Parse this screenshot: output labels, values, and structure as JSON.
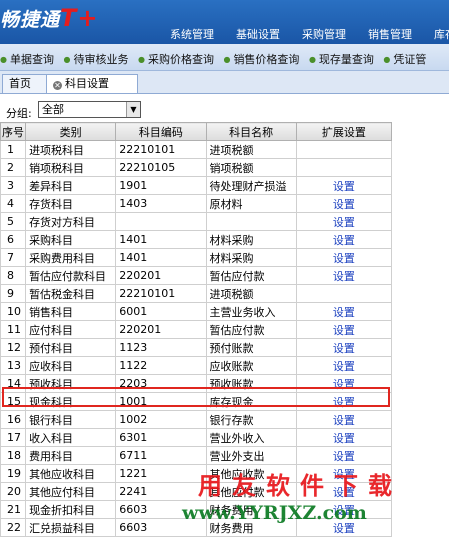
{
  "app": {
    "logo_text": "畅捷通",
    "logo_mark": "T+"
  },
  "main_nav": [
    "系统管理",
    "基础设置",
    "采购管理",
    "销售管理",
    "库存"
  ],
  "quick_links": [
    "单据查询",
    "待审核业务",
    "采购价格查询",
    "销售价格查询",
    "现存量查询",
    "凭证管"
  ],
  "tabs": {
    "home": "首页",
    "active": "科目设置"
  },
  "filter": {
    "label": "分组:",
    "value": "全部"
  },
  "table": {
    "headers": [
      "序号",
      "类别",
      "科目编码",
      "科目名称",
      "扩展设置"
    ],
    "rows": [
      {
        "no": "1",
        "type": "进项税科目",
        "code": "22210101",
        "name": "进项税额",
        "set": ""
      },
      {
        "no": "2",
        "type": "销项税科目",
        "code": "22210105",
        "name": "销项税额",
        "set": ""
      },
      {
        "no": "3",
        "type": "差异科目",
        "code": "1901",
        "name": "待处理财产损溢",
        "set": "设置"
      },
      {
        "no": "4",
        "type": "存货科目",
        "code": "1403",
        "name": "原材料",
        "set": "设置"
      },
      {
        "no": "5",
        "type": "存货对方科目",
        "code": "",
        "name": "",
        "set": "设置"
      },
      {
        "no": "6",
        "type": "采购科目",
        "code": "1401",
        "name": "材料采购",
        "set": "设置"
      },
      {
        "no": "7",
        "type": "采购费用科目",
        "code": "1401",
        "name": "材料采购",
        "set": "设置"
      },
      {
        "no": "8",
        "type": "暂估应付款科目",
        "code": "220201",
        "name": "暂估应付款",
        "set": "设置"
      },
      {
        "no": "9",
        "type": "暂估税金科目",
        "code": "22210101",
        "name": "进项税额",
        "set": ""
      },
      {
        "no": "10",
        "type": "销售科目",
        "code": "6001",
        "name": "主营业务收入",
        "set": "设置"
      },
      {
        "no": "11",
        "type": "应付科目",
        "code": "220201",
        "name": "暂估应付款",
        "set": "设置"
      },
      {
        "no": "12",
        "type": "预付科目",
        "code": "1123",
        "name": "预付账款",
        "set": "设置"
      },
      {
        "no": "13",
        "type": "应收科目",
        "code": "1122",
        "name": "应收账款",
        "set": "设置"
      },
      {
        "no": "14",
        "type": "预收科目",
        "code": "2203",
        "name": "预收账款",
        "set": "设置"
      },
      {
        "no": "15",
        "type": "现金科目",
        "code": "1001",
        "name": "库存现金",
        "set": "设置"
      },
      {
        "no": "16",
        "type": "银行科目",
        "code": "1002",
        "name": "银行存款",
        "set": "设置"
      },
      {
        "no": "17",
        "type": "收入科目",
        "code": "6301",
        "name": "营业外收入",
        "set": "设置"
      },
      {
        "no": "18",
        "type": "费用科目",
        "code": "6711",
        "name": "营业外支出",
        "set": "设置"
      },
      {
        "no": "19",
        "type": "其他应收科目",
        "code": "1221",
        "name": "其他应收款",
        "set": "设置"
      },
      {
        "no": "20",
        "type": "其他应付科目",
        "code": "2241",
        "name": "其他应付款",
        "set": "设置"
      },
      {
        "no": "21",
        "type": "现金折扣科目",
        "code": "6603",
        "name": "财务费用",
        "set": "设置"
      },
      {
        "no": "22",
        "type": "汇兑损益科目",
        "code": "6603",
        "name": "财务费用",
        "set": "设置"
      }
    ]
  },
  "watermark": {
    "cn": "用友软件下载",
    "url": "www.YYRJXZ.com"
  },
  "colors": {
    "accent": "#1a56a6",
    "highlight": "#e0261f",
    "link": "#1a3fbf"
  }
}
